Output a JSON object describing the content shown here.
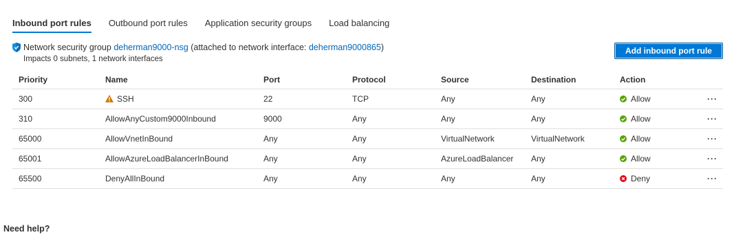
{
  "tabs": [
    "Inbound port rules",
    "Outbound port rules",
    "Application security groups",
    "Load balancing"
  ],
  "nsg": {
    "prefix": "Network security group",
    "nsg_name": "deherman9000-nsg",
    "attached_text": "(attached to network interface:",
    "nic_name": "deherman9000865",
    "close_paren": ")",
    "impacts": "Impacts 0 subnets, 1 network interfaces"
  },
  "add_button": "Add inbound port rule",
  "table": {
    "columns": [
      "Priority",
      "Name",
      "Port",
      "Protocol",
      "Source",
      "Destination",
      "Action"
    ],
    "rows": [
      {
        "priority": "300",
        "name": "SSH",
        "warning": true,
        "port": "22",
        "protocol": "TCP",
        "source": "Any",
        "destination": "Any",
        "action": "Allow"
      },
      {
        "priority": "310",
        "name": "AllowAnyCustom9000Inbound",
        "warning": false,
        "port": "9000",
        "protocol": "Any",
        "source": "Any",
        "destination": "Any",
        "action": "Allow"
      },
      {
        "priority": "65000",
        "name": "AllowVnetInBound",
        "warning": false,
        "port": "Any",
        "protocol": "Any",
        "source": "VirtualNetwork",
        "destination": "VirtualNetwork",
        "action": "Allow"
      },
      {
        "priority": "65001",
        "name": "AllowAzureLoadBalancerInBound",
        "warning": false,
        "port": "Any",
        "protocol": "Any",
        "source": "AzureLoadBalancer",
        "destination": "Any",
        "action": "Allow"
      },
      {
        "priority": "65500",
        "name": "DenyAllInBound",
        "warning": false,
        "port": "Any",
        "protocol": "Any",
        "source": "Any",
        "destination": "Any",
        "action": "Deny"
      }
    ],
    "more_glyph": "···"
  },
  "help": "Need help?",
  "colors": {
    "accent": "#0078d4",
    "allow": "#57a300",
    "deny": "#e00b1c",
    "warning": "#d47500"
  }
}
